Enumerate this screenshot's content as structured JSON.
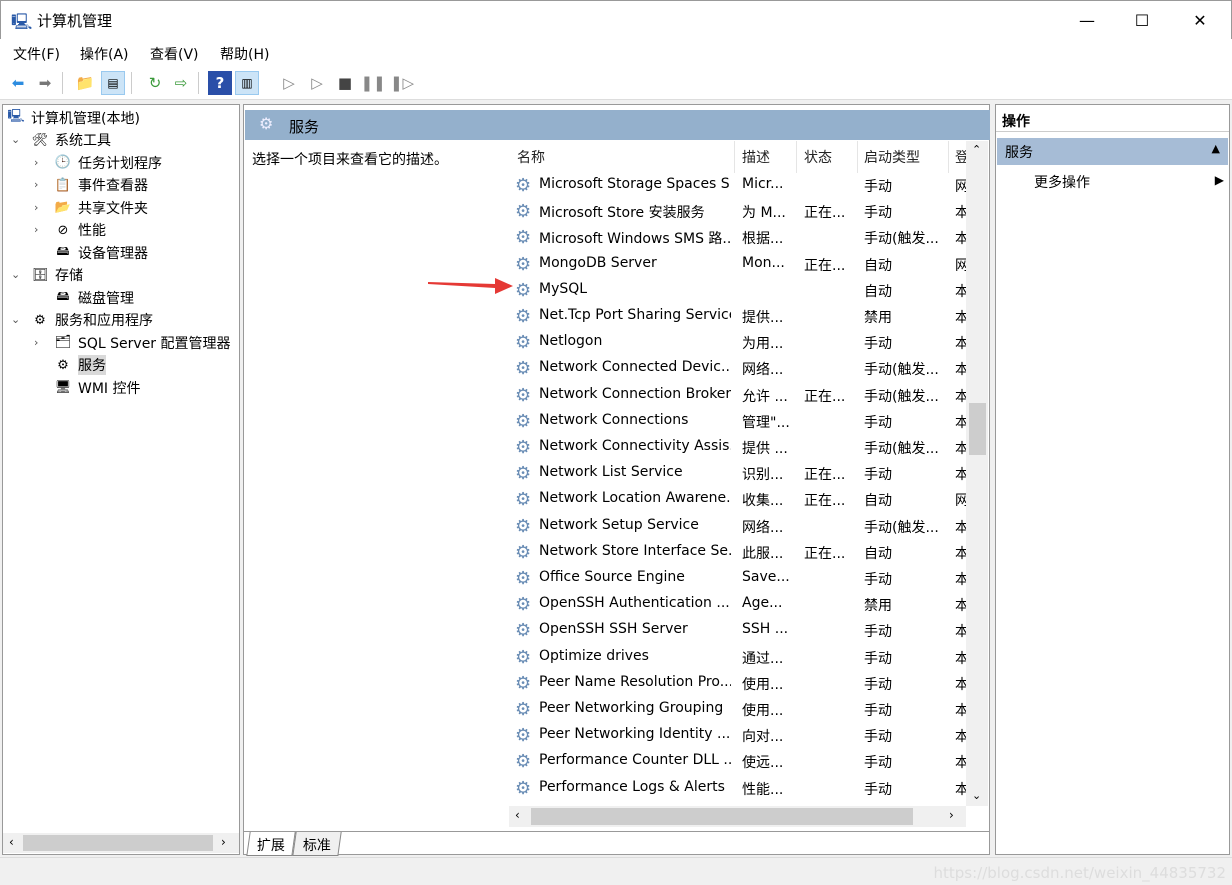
{
  "window": {
    "title": "计算机管理",
    "minimize": "—",
    "maximize": "☐",
    "close": "✕"
  },
  "menu": [
    "文件(F)",
    "操作(A)",
    "查看(V)",
    "帮助(H)"
  ],
  "toolbar": [
    "back",
    "forward",
    "up-folder",
    "show-hide-tree",
    "refresh",
    "export",
    "help",
    "show-action-pane",
    "start",
    "start-alt",
    "stop",
    "pause",
    "resume"
  ],
  "tree": {
    "root": "计算机管理(本地)",
    "items": [
      {
        "label": "系统工具",
        "level": 1,
        "expanded": true
      },
      {
        "label": "任务计划程序",
        "level": 2,
        "expandable": true
      },
      {
        "label": "事件查看器",
        "level": 2,
        "expandable": true
      },
      {
        "label": "共享文件夹",
        "level": 2,
        "expandable": true
      },
      {
        "label": "性能",
        "level": 2,
        "expandable": true
      },
      {
        "label": "设备管理器",
        "level": 2
      },
      {
        "label": "存储",
        "level": 1,
        "expanded": true
      },
      {
        "label": "磁盘管理",
        "level": 2
      },
      {
        "label": "服务和应用程序",
        "level": 1,
        "expanded": true
      },
      {
        "label": "SQL Server 配置管理器",
        "level": 2,
        "expandable": true
      },
      {
        "label": "服务",
        "level": 2,
        "selected": true
      },
      {
        "label": "WMI 控件",
        "level": 2
      }
    ]
  },
  "center": {
    "title": "服务",
    "description": "选择一个项目来查看它的描述。",
    "columns": [
      "名称",
      "描述",
      "状态",
      "启动类型",
      "登"
    ],
    "rows": [
      [
        "Microsoft Storage Spaces S...",
        "Micr...",
        "",
        "手动",
        "网"
      ],
      [
        "Microsoft Store 安装服务",
        "为 M...",
        "正在...",
        "手动",
        "本"
      ],
      [
        "Microsoft Windows SMS 路...",
        "根据...",
        "",
        "手动(触发...",
        "本"
      ],
      [
        "MongoDB Server",
        "Mon...",
        "正在...",
        "自动",
        "网"
      ],
      [
        "MySQL",
        "",
        "",
        "自动",
        "本"
      ],
      [
        "Net.Tcp Port Sharing Service",
        "提供...",
        "",
        "禁用",
        "本"
      ],
      [
        "Netlogon",
        "为用...",
        "",
        "手动",
        "本"
      ],
      [
        "Network Connected Devic...",
        "网络...",
        "",
        "手动(触发...",
        "本"
      ],
      [
        "Network Connection Broker",
        "允许 ...",
        "正在...",
        "手动(触发...",
        "本"
      ],
      [
        "Network Connections",
        "管理\"...",
        "",
        "手动",
        "本"
      ],
      [
        "Network Connectivity Assis...",
        "提供 ...",
        "",
        "手动(触发...",
        "本"
      ],
      [
        "Network List Service",
        "识别...",
        "正在...",
        "手动",
        "本"
      ],
      [
        "Network Location Awarene...",
        "收集...",
        "正在...",
        "自动",
        "网"
      ],
      [
        "Network Setup Service",
        "网络...",
        "",
        "手动(触发...",
        "本"
      ],
      [
        "Network Store Interface Se...",
        "此服...",
        "正在...",
        "自动",
        "本"
      ],
      [
        "Office  Source Engine",
        "Save...",
        "",
        "手动",
        "本"
      ],
      [
        "OpenSSH Authentication ...",
        "Age...",
        "",
        "禁用",
        "本"
      ],
      [
        "OpenSSH SSH Server",
        "SSH ...",
        "",
        "手动",
        "本"
      ],
      [
        "Optimize drives",
        "通过...",
        "",
        "手动",
        "本"
      ],
      [
        "Peer Name Resolution Pro...",
        "使用...",
        "",
        "手动",
        "本"
      ],
      [
        "Peer Networking Grouping",
        "使用...",
        "",
        "手动",
        "本"
      ],
      [
        "Peer Networking Identity ...",
        "向对...",
        "",
        "手动",
        "本"
      ],
      [
        "Performance Counter DLL ...",
        "使远...",
        "",
        "手动",
        "本"
      ],
      [
        "Performance Logs & Alerts",
        "性能...",
        "",
        "手动",
        "本"
      ]
    ],
    "tabs": [
      "扩展",
      "标准"
    ],
    "annotation_color": "#e53935"
  },
  "actions": {
    "title": "操作",
    "section": "服务",
    "more": "更多操作"
  },
  "watermark": "https://blog.csdn.net/weixin_44835732"
}
